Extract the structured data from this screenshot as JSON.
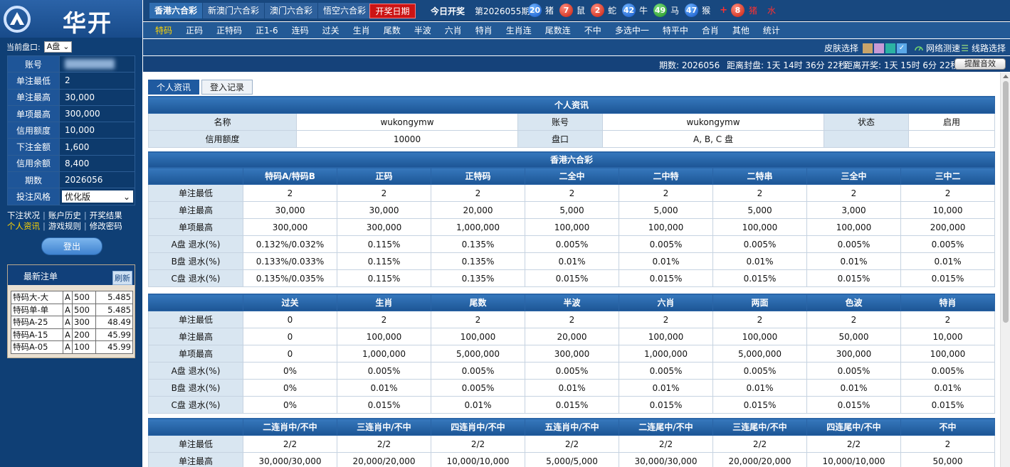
{
  "brand": {
    "name": "华开"
  },
  "sidebar": {
    "panel_label": "当前盘口:",
    "panel_value": "A盘",
    "account": [
      {
        "label": "账号",
        "value": ""
      },
      {
        "label": "单注最低",
        "value": "2"
      },
      {
        "label": "单注最高",
        "value": "30,000"
      },
      {
        "label": "单项最高",
        "value": "300,000"
      },
      {
        "label": "信用额度",
        "value": "10,000"
      },
      {
        "label": "下注金额",
        "value": "1,600"
      },
      {
        "label": "信用余额",
        "value": "8,400"
      },
      {
        "label": "期数",
        "value": "2026056"
      },
      {
        "label": "投注风格",
        "value": "优化版"
      }
    ],
    "links": [
      "下注状况",
      "账户历史",
      "开奖结果",
      "个人资讯",
      "游戏规则",
      "修改密码"
    ],
    "logout": "登出",
    "recent_title": "最新注单",
    "refresh": "刷新",
    "recent": [
      [
        "特码大-大",
        "A",
        "500",
        "5.485"
      ],
      [
        "特码单-单",
        "A",
        "500",
        "5.485"
      ],
      [
        "特码A-25",
        "A",
        "300",
        "48.49"
      ],
      [
        "特码A-15",
        "A",
        "200",
        "45.99"
      ],
      [
        "特码A-05",
        "A",
        "100",
        "45.99"
      ]
    ]
  },
  "topbar": {
    "lotteries": [
      "香港六合彩",
      "新澳门六合彩",
      "澳门六合彩",
      "悟空六合彩"
    ],
    "draw_date": "开奖日期",
    "today": "今日开奖",
    "period": "第2026055期",
    "balls": [
      {
        "num": "20",
        "zodiac": "猪",
        "color": "blue"
      },
      {
        "num": "7",
        "zodiac": "鼠",
        "color": "red"
      },
      {
        "num": "2",
        "zodiac": "蛇",
        "color": "red"
      },
      {
        "num": "42",
        "zodiac": "牛",
        "color": "blue"
      },
      {
        "num": "49",
        "zodiac": "马",
        "color": "green"
      },
      {
        "num": "47",
        "zodiac": "猴",
        "color": "blue"
      }
    ],
    "special": {
      "num": "8",
      "zodiac": "猪",
      "extra": "水",
      "color": "red"
    }
  },
  "nav": [
    "特码",
    "正码",
    "正特码",
    "正1-6",
    "连码",
    "过关",
    "生肖",
    "尾数",
    "半波",
    "六肖",
    "特肖",
    "生肖连",
    "尾数连",
    "不中",
    "多选中一",
    "特平中",
    "合肖",
    "其他",
    "统计"
  ],
  "toolbar": {
    "skin": "皮肤选择",
    "net": "网络测速",
    "line": "线路选择",
    "swatches": [
      "#c8a46a",
      "#c79ad6",
      "#2bb3a3",
      "#5aa8e8"
    ]
  },
  "status": {
    "period": "期数: 2026056",
    "close": "距离封盘: 1天 14时 36分 22秒",
    "open": "距离开奖: 1天 15时 6分 22秒",
    "remind": "提醒音效"
  },
  "tabs": [
    "个人资讯",
    "登入记录"
  ],
  "info": {
    "title": "个人资讯",
    "name_label": "名称",
    "name": "wukongymw",
    "account_label": "账号",
    "account": "wukongymw",
    "status_label": "状态",
    "status": "启用",
    "credit_label": "信用额度",
    "credit": "10000",
    "panel_label": "盘口",
    "panel": "A, B, C 盘"
  },
  "tables": [
    {
      "caption": "香港六合彩",
      "headers": [
        "特码A/特码B",
        "正码",
        "正特码",
        "二全中",
        "二中特",
        "二特串",
        "三全中",
        "三中二"
      ],
      "rows": [
        {
          "label": "单注最低",
          "cells": [
            "2",
            "2",
            "2",
            "2",
            "2",
            "2",
            "2",
            "2"
          ]
        },
        {
          "label": "单注最高",
          "cells": [
            "30,000",
            "30,000",
            "20,000",
            "5,000",
            "5,000",
            "5,000",
            "3,000",
            "10,000"
          ]
        },
        {
          "label": "单项最高",
          "cells": [
            "300,000",
            "300,000",
            "1,000,000",
            "100,000",
            "100,000",
            "100,000",
            "100,000",
            "200,000"
          ]
        },
        {
          "label": "A盘 退水(%)",
          "cells": [
            "0.132%/0.032%",
            "0.115%",
            "0.135%",
            "0.005%",
            "0.005%",
            "0.005%",
            "0.005%",
            "0.005%"
          ]
        },
        {
          "label": "B盘 退水(%)",
          "cells": [
            "0.133%/0.033%",
            "0.115%",
            "0.135%",
            "0.01%",
            "0.01%",
            "0.01%",
            "0.01%",
            "0.01%"
          ]
        },
        {
          "label": "C盘 退水(%)",
          "cells": [
            "0.135%/0.035%",
            "0.115%",
            "0.135%",
            "0.015%",
            "0.015%",
            "0.015%",
            "0.015%",
            "0.015%"
          ]
        }
      ]
    },
    {
      "caption": "",
      "headers": [
        "过关",
        "生肖",
        "尾数",
        "半波",
        "六肖",
        "两面",
        "色波",
        "特肖"
      ],
      "rows": [
        {
          "label": "单注最低",
          "cells": [
            "0",
            "2",
            "2",
            "2",
            "2",
            "2",
            "2",
            "2"
          ]
        },
        {
          "label": "单注最高",
          "cells": [
            "0",
            "100,000",
            "100,000",
            "20,000",
            "100,000",
            "100,000",
            "50,000",
            "10,000"
          ]
        },
        {
          "label": "单项最高",
          "cells": [
            "0",
            "1,000,000",
            "5,000,000",
            "300,000",
            "1,000,000",
            "5,000,000",
            "300,000",
            "100,000"
          ]
        },
        {
          "label": "A盘 退水(%)",
          "cells": [
            "0%",
            "0.005%",
            "0.005%",
            "0.005%",
            "0.005%",
            "0.005%",
            "0.005%",
            "0.005%"
          ]
        },
        {
          "label": "B盘 退水(%)",
          "cells": [
            "0%",
            "0.01%",
            "0.005%",
            "0.01%",
            "0.01%",
            "0.01%",
            "0.01%",
            "0.01%"
          ]
        },
        {
          "label": "C盘 退水(%)",
          "cells": [
            "0%",
            "0.015%",
            "0.01%",
            "0.015%",
            "0.015%",
            "0.015%",
            "0.015%",
            "0.015%"
          ]
        }
      ]
    },
    {
      "caption": "",
      "headers": [
        "二连肖中/不中",
        "三连肖中/不中",
        "四连肖中/不中",
        "五连肖中/不中",
        "二连尾中/不中",
        "三连尾中/不中",
        "四连尾中/不中",
        "不中"
      ],
      "rows": [
        {
          "label": "单注最低",
          "cells": [
            "2/2",
            "2/2",
            "2/2",
            "2/2",
            "2/2",
            "2/2",
            "2/2",
            "2"
          ]
        },
        {
          "label": "单注最高",
          "cells": [
            "30,000/30,000",
            "20,000/20,000",
            "10,000/10,000",
            "5,000/5,000",
            "30,000/30,000",
            "20,000/20,000",
            "10,000/10,000",
            "50,000"
          ]
        }
      ]
    }
  ]
}
